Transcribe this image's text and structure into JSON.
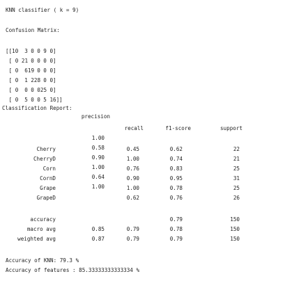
{
  "title": "KNN classifier ( k = 9)",
  "confusion_label": "Confusion Matrix:",
  "matrix": [
    [
      "[[10",
      "3",
      "0",
      "0",
      "9",
      "0]"
    ],
    [
      " [ 0",
      "21",
      "0",
      "0",
      "0",
      "0]"
    ],
    [
      " [ 0",
      "6",
      "19",
      "0",
      "0",
      "0]"
    ],
    [
      " [ 0",
      "1",
      "2",
      "28",
      "0",
      "0]"
    ],
    [
      " [ 0",
      "0",
      "0",
      "0",
      "25",
      "0]"
    ],
    [
      " [ 0",
      "5",
      "0",
      "0",
      "5",
      "16]]"
    ]
  ],
  "report_label": "Classification Report:",
  "headers": [
    "precision",
    "recall",
    "f1-score",
    "support"
  ],
  "rows": [
    {
      "label": "Cherry",
      "precision": "1.00",
      "recall": "0.45",
      "f1": "0.62",
      "support": "22"
    },
    {
      "label": "CherryD",
      "precision": "0.58",
      "recall": "1.00",
      "f1": "0.74",
      "support": "21"
    },
    {
      "label": "Corn",
      "precision": "0.90",
      "recall": "0.76",
      "f1": "0.83",
      "support": "25"
    },
    {
      "label": "CornD",
      "precision": "1.00",
      "recall": "0.90",
      "f1": "0.95",
      "support": "31"
    },
    {
      "label": "Grape",
      "precision": "0.64",
      "recall": "1.00",
      "f1": "0.78",
      "support": "25"
    },
    {
      "label": "GrapeD",
      "precision": "1.00",
      "recall": "0.62",
      "f1": "0.76",
      "support": "26"
    }
  ],
  "summary": [
    {
      "label": "accuracy",
      "precision": "",
      "recall": "",
      "f1": "0.79",
      "support": "150"
    },
    {
      "label": "macro avg",
      "precision": "0.85",
      "recall": "0.79",
      "f1": "0.78",
      "support": "150"
    },
    {
      "label": "weighted avg",
      "precision": "0.87",
      "recall": "0.79",
      "f1": "0.79",
      "support": "150"
    }
  ],
  "accuracy_line": "Accuracy of KNN: 79.3 %",
  "features_line": "Accuracy of features : 85.33333333333334 %"
}
